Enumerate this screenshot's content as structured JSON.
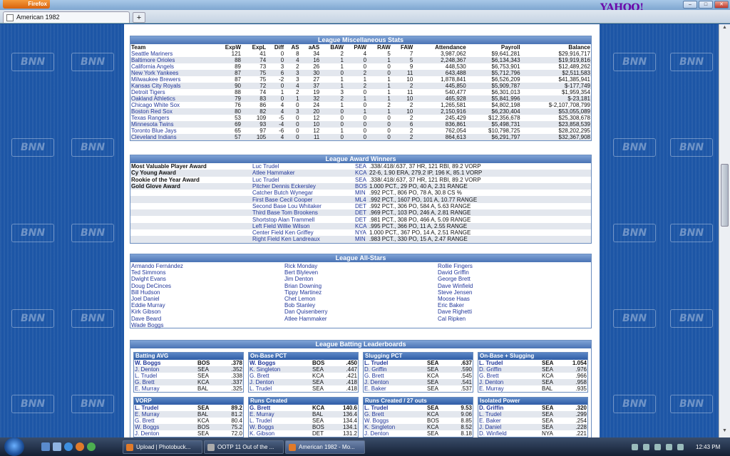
{
  "browser": {
    "menu_label": "Firefox",
    "tab_title": "American 1982",
    "new_tab": "+",
    "brand": "YAHOO!",
    "min": "–",
    "max": "□",
    "close": "✕"
  },
  "watermark": "BNN",
  "misc": {
    "title": "League Miscellaneous Stats",
    "headers": [
      "Team",
      "ExpW",
      "ExpL",
      "Diff",
      "AS",
      "aAS",
      "BAW",
      "PAW",
      "RAW",
      "FAW",
      "Attendance",
      "Payroll",
      "Balance"
    ],
    "rows": [
      [
        "Seattle Mariners",
        "121",
        "41",
        "0",
        "8",
        "34",
        "2",
        "4",
        "5",
        "7",
        "3,987,062",
        "$9,641,281",
        "$29,916,717"
      ],
      [
        "Baltimore Orioles",
        "88",
        "74",
        "0",
        "4",
        "16",
        "1",
        "0",
        "1",
        "5",
        "2,248,367",
        "$6,134,343",
        "$19,919,816"
      ],
      [
        "California Angels",
        "89",
        "73",
        "3",
        "2",
        "26",
        "1",
        "0",
        "0",
        "9",
        "448,530",
        "$6,753,901",
        "$12,489,262"
      ],
      [
        "New York Yankees",
        "87",
        "75",
        "6",
        "3",
        "30",
        "0",
        "2",
        "0",
        "11",
        "643,488",
        "$5,712,796",
        "$2,511,583"
      ],
      [
        "Milwaukee Brewers",
        "87",
        "75",
        "-2",
        "3",
        "27",
        "1",
        "1",
        "1",
        "10",
        "1,878,841",
        "$6,526,209",
        "$41,385,941"
      ],
      [
        "Kansas City Royals",
        "90",
        "72",
        "0",
        "4",
        "37",
        "1",
        "2",
        "1",
        "2",
        "445,850",
        "$5,909,787",
        "$-177,749"
      ],
      [
        "Detroit Tigers",
        "88",
        "74",
        "1",
        "2",
        "19",
        "3",
        "0",
        "1",
        "11",
        "540,477",
        "$6,301,013",
        "$1,959,354"
      ],
      [
        "Oakland Athletics",
        "79",
        "83",
        "0",
        "1",
        "32",
        "2",
        "1",
        "1",
        "10",
        "465,928",
        "$5,841,996",
        "$-23,181"
      ],
      [
        "Chicago White Sox",
        "76",
        "86",
        "4",
        "0",
        "24",
        "1",
        "0",
        "2",
        "2",
        "1,265,581",
        "$4,802,198",
        "$-2,107,708,799"
      ],
      [
        "Boston Red Sox",
        "80",
        "82",
        "4",
        "3",
        "20",
        "0",
        "1",
        "1",
        "10",
        "2,150,916",
        "$6,230,404",
        "$53,055,089"
      ],
      [
        "Texas Rangers",
        "53",
        "109",
        "-5",
        "0",
        "12",
        "0",
        "0",
        "0",
        "2",
        "245,429",
        "$12,356,678",
        "$25,308,678"
      ],
      [
        "Minnesota Twins",
        "69",
        "93",
        "-4",
        "0",
        "10",
        "0",
        "0",
        "0",
        "6",
        "836,861",
        "$5,498,731",
        "$23,858,539"
      ],
      [
        "Toronto Blue Jays",
        "65",
        "97",
        "-6",
        "0",
        "12",
        "1",
        "0",
        "0",
        "2",
        "762,054",
        "$10,798,725",
        "$28,202,295"
      ],
      [
        "Cleveland Indians",
        "57",
        "105",
        "4",
        "0",
        "11",
        "0",
        "0",
        "0",
        "2",
        "864,613",
        "$6,291,797",
        "$32,367,908"
      ]
    ]
  },
  "awards": {
    "title": "League Award Winners",
    "rows": [
      [
        "Most Valuable Player Award",
        "Luc Trudel",
        "SEA",
        ".338/.418/.637, 37 HR, 121 RBI, 89.2 VORP"
      ],
      [
        "Cy Young Award",
        "Atlee Hammaker",
        "KCA",
        "22-6, 1.90 ERA, 279.2 IP, 196 K, 85.1 VORP"
      ],
      [
        "Rookie of the Year Award",
        "Luc Trudel",
        "SEA",
        ".338/.418/.637, 37 HR, 121 RBI, 89.2 VORP"
      ],
      [
        "Gold Glove Award",
        "Pitcher Dennis Eckersley",
        "BOS",
        "1.000 PCT., 29 PO, 40 A, 2.31 RANGE"
      ],
      [
        "",
        "Catcher Butch Wynegar",
        "MIN",
        ".992 PCT., 806 PO, 78 A, 30.8 CS %"
      ],
      [
        "",
        "First Base Cecil Cooper",
        "ML4",
        ".992 PCT., 1607 PO, 101 A, 10.77 RANGE"
      ],
      [
        "",
        "Second Base Lou Whitaker",
        "DET",
        ".992 PCT., 306 PO, 584 A, 5.63 RANGE"
      ],
      [
        "",
        "Third Base Tom Brookens",
        "DET",
        ".969 PCT., 103 PO, 246 A, 2.81 RANGE"
      ],
      [
        "",
        "Shortstop Alan Trammell",
        "DET",
        ".981 PCT., 308 PO, 466 A, 5.09 RANGE"
      ],
      [
        "",
        "Left Field Willie Wilson",
        "KCA",
        ".995 PCT., 366 PO, 11 A, 2.55 RANGE"
      ],
      [
        "",
        "Center Field Ken Griffey",
        "NYA",
        "1.000 PCT., 367 PO, 14 A, 2.51 RANGE"
      ],
      [
        "",
        "Right Field Ken Landreaux",
        "MIN",
        ".983 PCT., 330 PO, 15 A, 2.47 RANGE"
      ]
    ]
  },
  "allstars": {
    "title": "League All-Stars",
    "col1": [
      "Armando Fernández",
      "Ted Simmons",
      "Dwight Evans",
      "Doug DeCinces",
      "Bill Hudson",
      "Joel Daniel",
      "Eddie Murray",
      "Kirk Gibson",
      "Dave Beard",
      "Wade Boggs"
    ],
    "col2": [
      "Rick Monday",
      "Bert Blyleven",
      "Jim Denton",
      "Brian Downing",
      "Tippy Martinez",
      "Chet Lemon",
      "Bob Stanley",
      "Dan Quisenberry",
      "Atlee Hammaker"
    ],
    "col3": [
      "Rollie Fingers",
      "David Griffin",
      "George Brett",
      "Dave Winfield",
      "Steve Jensen",
      "Moose Haas",
      "Eric Baker",
      "Dave Righetti",
      "Cal Ripken"
    ]
  },
  "batting": {
    "title": "League Batting Leaderboards",
    "boards": [
      {
        "title": "Batting AVG",
        "rows": [
          [
            "W. Boggs",
            "BOS",
            ".378"
          ],
          [
            "J. Denton",
            "SEA",
            ".352"
          ],
          [
            "L. Trudel",
            "SEA",
            ".338"
          ],
          [
            "G. Brett",
            "KCA",
            ".337"
          ],
          [
            "E. Murray",
            "BAL",
            ".325"
          ]
        ]
      },
      {
        "title": "On-Base PCT",
        "rows": [
          [
            "W. Boggs",
            "BOS",
            ".450"
          ],
          [
            "K. Singleton",
            "SEA",
            ".447"
          ],
          [
            "G. Brett",
            "KCA",
            ".421"
          ],
          [
            "J. Denton",
            "SEA",
            ".418"
          ],
          [
            "L. Trudel",
            "SEA",
            ".418"
          ]
        ]
      },
      {
        "title": "Slugging PCT",
        "rows": [
          [
            "L. Trudel",
            "SEA",
            ".637"
          ],
          [
            "D. Griffin",
            "SEA",
            ".590"
          ],
          [
            "G. Brett",
            "KCA",
            ".545"
          ],
          [
            "J. Denton",
            "SEA",
            ".541"
          ],
          [
            "E. Baker",
            "SEA",
            ".537"
          ]
        ]
      },
      {
        "title": "On-Base + Slugging",
        "rows": [
          [
            "L. Trudel",
            "SEA",
            "1.054"
          ],
          [
            "D. Griffin",
            "SEA",
            ".976"
          ],
          [
            "G. Brett",
            "KCA",
            ".966"
          ],
          [
            "J. Denton",
            "SEA",
            ".958"
          ],
          [
            "E. Murray",
            "BAL",
            ".935"
          ]
        ]
      },
      {
        "title": "VORP",
        "rows": [
          [
            "L. Trudel",
            "SEA",
            "89.2"
          ],
          [
            "E. Murray",
            "BAL",
            "81.2"
          ],
          [
            "G. Brett",
            "KCA",
            "80.4"
          ],
          [
            "W. Boggs",
            "BOS",
            "75.2"
          ],
          [
            "J. Denton",
            "SEA",
            "72.0"
          ]
        ]
      },
      {
        "title": "Runs Created",
        "rows": [
          [
            "G. Brett",
            "KCA",
            "140.6"
          ],
          [
            "E. Murray",
            "BAL",
            "136.4"
          ],
          [
            "L. Trudel",
            "SEA",
            "134.4"
          ],
          [
            "W. Boggs",
            "BOS",
            "134.1"
          ],
          [
            "K. Gibson",
            "DET",
            "131.2"
          ]
        ]
      },
      {
        "title": "Runs Created / 27 outs",
        "rows": [
          [
            "L. Trudel",
            "SEA",
            "9.53"
          ],
          [
            "G. Brett",
            "KCA",
            "9.06"
          ],
          [
            "W. Boggs",
            "BOS",
            "8.85"
          ],
          [
            "K. Singleton",
            "KCA",
            "8.52"
          ],
          [
            "J. Denton",
            "SEA",
            "8.18"
          ]
        ]
      },
      {
        "title": "Isolated Power",
        "rows": [
          [
            "D. Griffin",
            "SEA",
            ".320"
          ],
          [
            "L. Trudel",
            "SEA",
            ".299"
          ],
          [
            "E. Baker",
            "SEA",
            ".254"
          ],
          [
            "J. Daniel",
            "SEA",
            ".228"
          ],
          [
            "D. Winfield",
            "NYA",
            ".221"
          ]
        ]
      }
    ]
  },
  "taskbar": {
    "items": [
      "Upload | Photobuck...",
      "OOTP 11 Out of the ...",
      "American 1982 - Mo..."
    ],
    "clock": "12:43 PM"
  }
}
